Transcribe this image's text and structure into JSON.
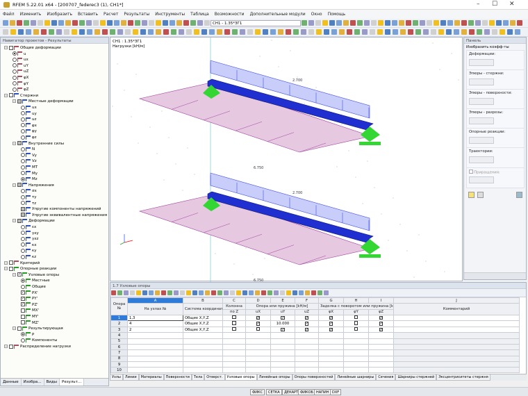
{
  "window": {
    "title": "RFEM 5.22.01 x64 - [200707_federec3 (1), CH1*]"
  },
  "menu": [
    "Файл",
    "Изменить",
    "Изобразить",
    "Вставить",
    "Расчет",
    "Результаты",
    "Инструменты",
    "Таблица",
    "Возможности",
    "Дополнительные модули",
    "Окно",
    "Помощь"
  ],
  "toolbar": {
    "load_combo": "CH1 - 1.35*ЗГ1"
  },
  "navigator": {
    "title": "Навигатор проектов - Результаты",
    "items": [
      "Общие деформации",
      "u",
      "ux",
      "uY",
      "uZ",
      "φX",
      "φY",
      "φZ",
      "Стержни",
      "Местные деформации",
      "ux",
      "uy",
      "uz",
      "φx",
      "φy",
      "φz",
      "Внутренние силы",
      "N",
      "Vy",
      "Vz",
      "MT",
      "My",
      "Mz",
      "Напряжения",
      "σx",
      "τy",
      "τz",
      "Упругие компоненты напряжений",
      "Упругие эквивалентные напряжения",
      "Деформации",
      "εx",
      "γxy",
      "γxz",
      "κx",
      "κy",
      "κz",
      "Критерий",
      "Опорные реакции",
      "Узловые опоры",
      "Местные",
      "Общие",
      "PX'",
      "PY'",
      "PZ'",
      "MX'",
      "MY'",
      "MZ'",
      "Результирующая",
      "P",
      "Компоненты",
      "Распределение нагрузки"
    ],
    "tabs": [
      "Данные",
      "Изобра...",
      "Виды",
      "Результ..."
    ]
  },
  "viewport": {
    "case_label": "CH1 : 1.35*ЗГ1",
    "units_label": "Нагрузки [kH/м]",
    "load_value": "2.700",
    "surface_value": "6.750",
    "colors": {
      "beam": "#1f2fd0",
      "load": "#c9cdfa",
      "surface": "#e6c8e0",
      "support": "#33d633"
    }
  },
  "panel": {
    "title": "Панель",
    "heading": "Изобразить коэфф-ты",
    "groups": [
      "Деформации:",
      "Эпюры - стержни:",
      "Эпюры - поверхности:",
      "Эпюры - разрезы:",
      "Опорные реакции:",
      "Траектории:"
    ],
    "increment_label": "Приращения:"
  },
  "table": {
    "title": "1.7 Узловые опоры",
    "col_letters": [
      "A",
      "B",
      "C",
      "D",
      "E",
      "F",
      "G",
      "H",
      "I",
      "J"
    ],
    "header_support_no": "Опора №",
    "headers": {
      "node": "На узлах №",
      "coord": "Система координат",
      "column_top": "Колонна",
      "column_bot": "по Z",
      "spring_group": "Опора или пружина [kH/м]",
      "ux": "uX",
      "uy": "uY",
      "uz": "uZ",
      "rot_group": "Заделка с поворотом или пружина [kHм/р",
      "px": "φX",
      "py": "φY",
      "pz": "φZ",
      "comment": "Комментарий"
    },
    "rows": [
      {
        "no": "1",
        "node": "1,3",
        "coord": "Общие X,Y,Z",
        "col": false,
        "ux": true,
        "uy": true,
        "uz": true,
        "px": true,
        "py": false,
        "pz": true
      },
      {
        "no": "2",
        "node": "4",
        "coord": "Общие X,Y,Z",
        "col": false,
        "ux": true,
        "uy": "10.000",
        "uz": true,
        "px": true,
        "py": false,
        "pz": true
      },
      {
        "no": "3",
        "node": "2",
        "coord": "Общие X,Y,Z",
        "col": false,
        "ux": false,
        "uy": true,
        "uz": true,
        "px": true,
        "py": false,
        "pz": true
      }
    ],
    "empty_rows": [
      "4",
      "5",
      "6",
      "7",
      "8",
      "9",
      "10"
    ]
  },
  "tabs": [
    "Узлы",
    "Линии",
    "Материалы",
    "Поверхности",
    "Тела",
    "Отверст.",
    "Узловые опоры",
    "Линейные опоры",
    "Опоры поверхностей",
    "Линейные шарниры",
    "Сечения",
    "Шарниры стержней",
    "Эксцентриситеты стержня"
  ],
  "active_tab": "Узловые опоры",
  "status": [
    "ФИКС",
    "СЕТКА",
    "ДЕКАРТ",
    "ФИКОБ",
    "НАПИН",
    "DXF"
  ]
}
